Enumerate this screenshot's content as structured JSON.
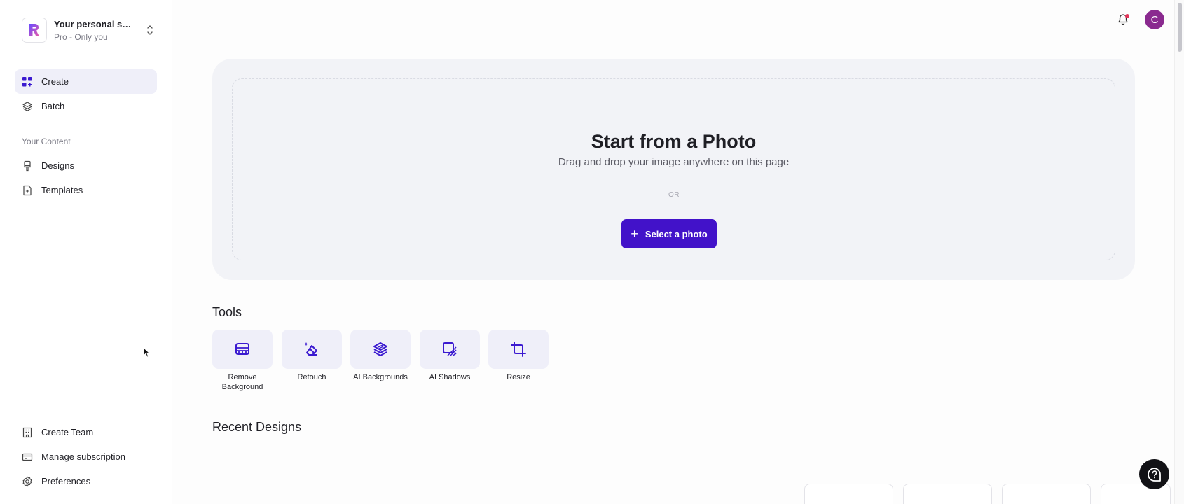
{
  "workspace": {
    "name": "Your personal sp...",
    "plan": "Pro - Only you"
  },
  "nav": {
    "create": "Create",
    "batch": "Batch",
    "section_label": "Your Content",
    "designs": "Designs",
    "templates": "Templates",
    "create_team": "Create Team",
    "manage_subscription": "Manage subscription",
    "preferences": "Preferences"
  },
  "user": {
    "initial": "C"
  },
  "hero": {
    "title": "Start from a Photo",
    "subtitle": "Drag and drop your image anywhere on this page",
    "or": "OR",
    "select_label": "Select a photo"
  },
  "tools": {
    "heading": "Tools",
    "items": [
      {
        "label": "Remove Background",
        "icon": "remove-background-icon"
      },
      {
        "label": "Retouch",
        "icon": "eraser-icon"
      },
      {
        "label": "AI Backgrounds",
        "icon": "layers-icon"
      },
      {
        "label": "AI Shadows",
        "icon": "shadow-icon"
      },
      {
        "label": "Resize",
        "icon": "crop-icon"
      }
    ]
  },
  "recent": {
    "heading": "Recent Designs"
  },
  "colors": {
    "accent": "#4212c9",
    "tool_icon": "#3b1ad0",
    "tile_bg": "#efeff9",
    "avatar": "#8a2a8f"
  }
}
